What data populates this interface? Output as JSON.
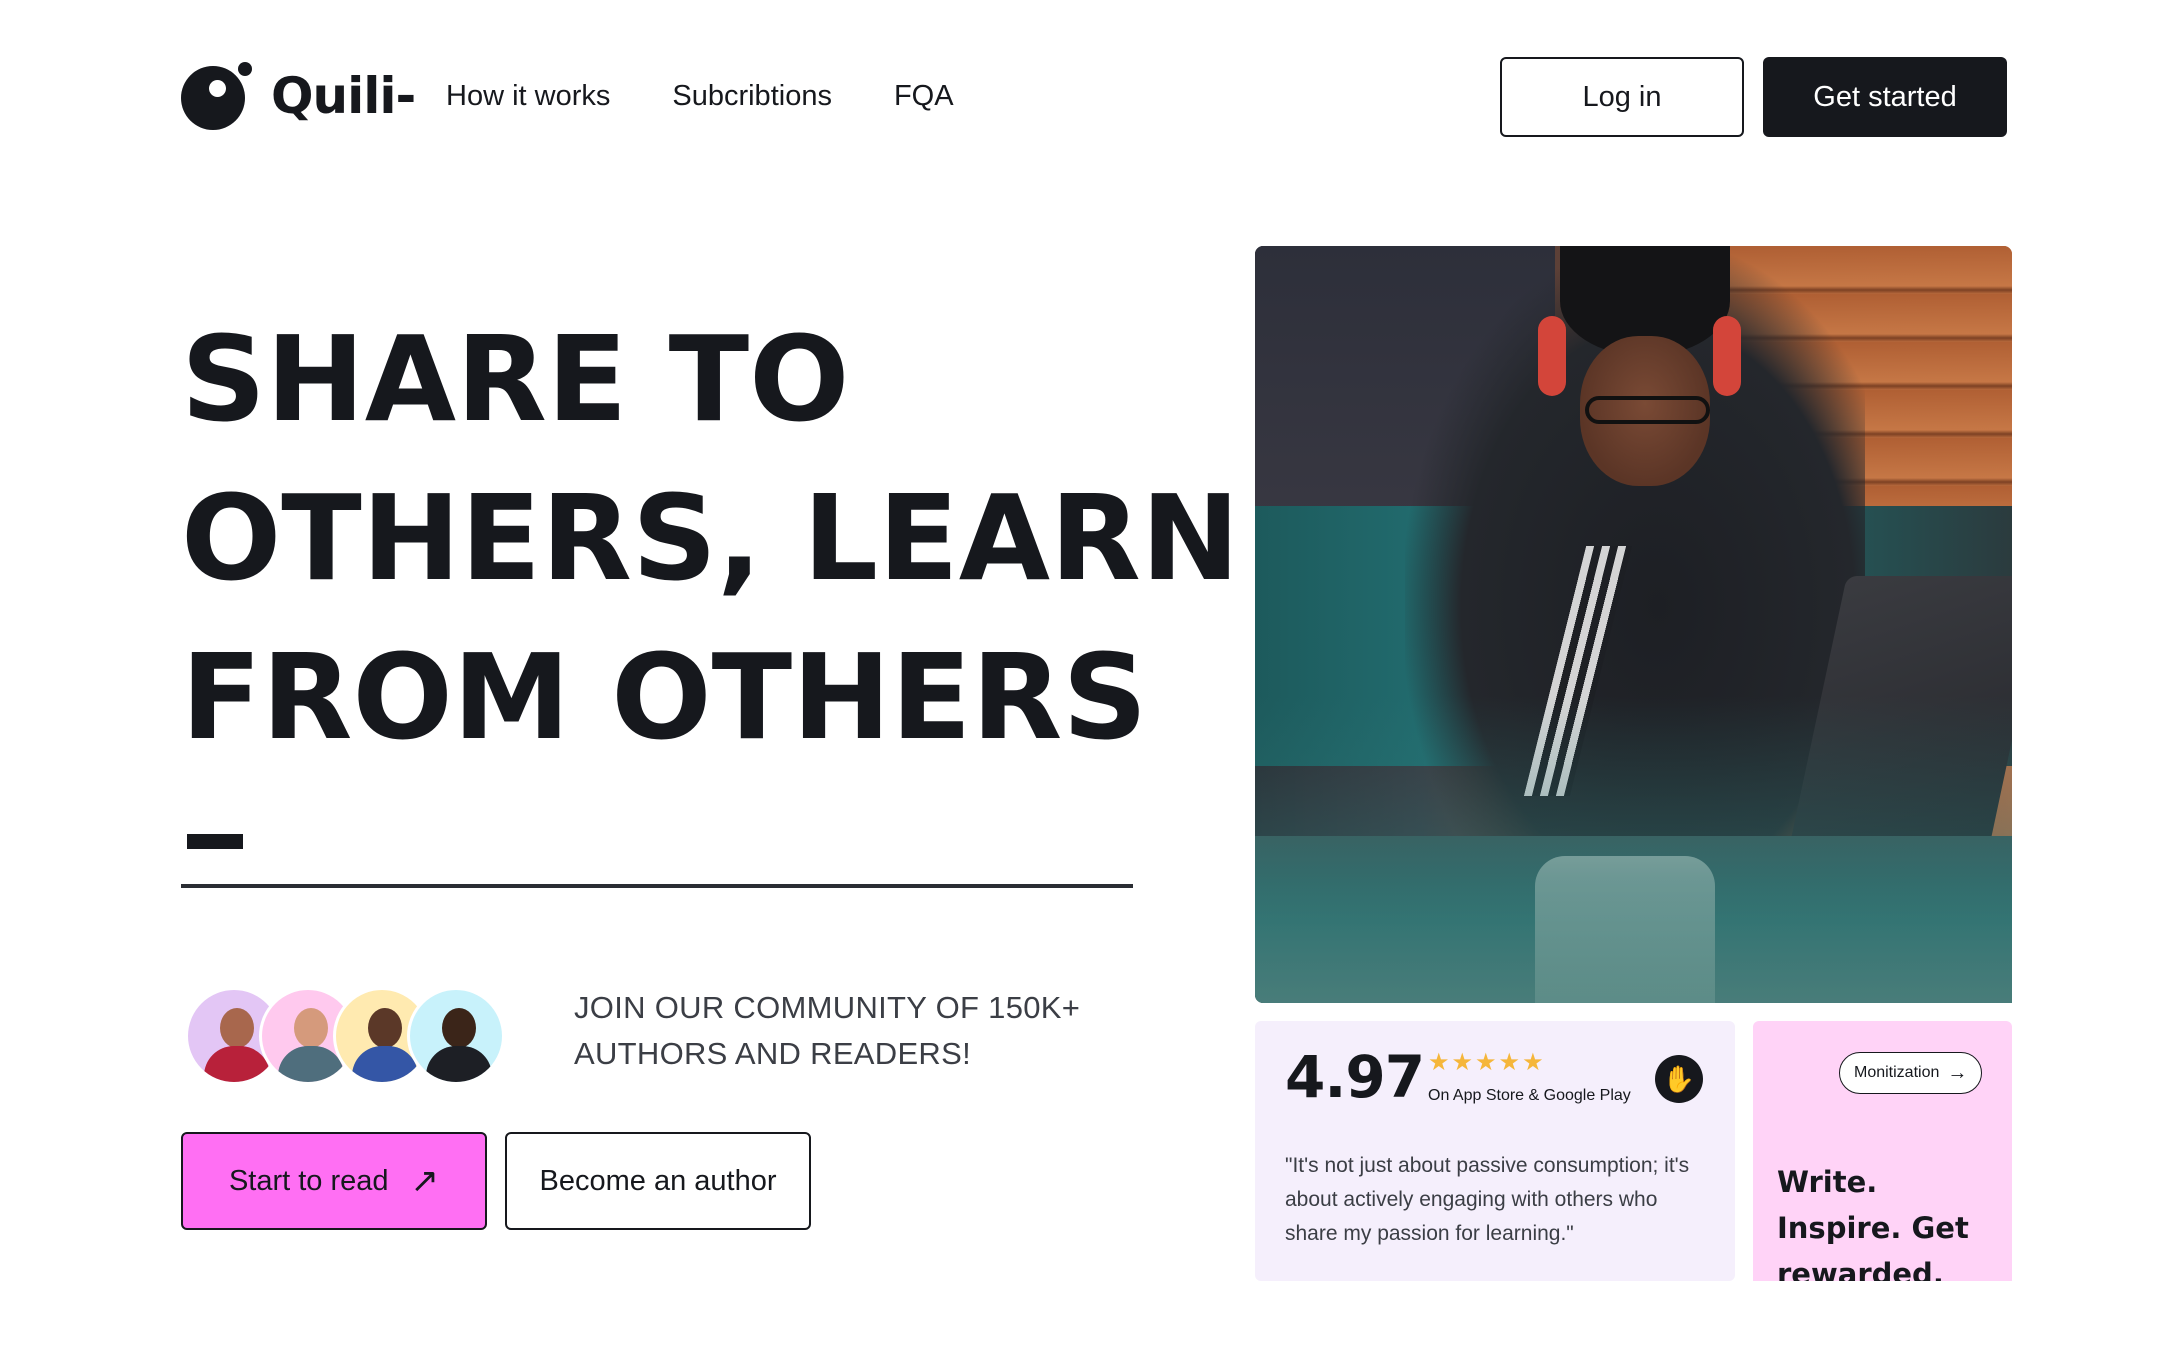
{
  "brand": {
    "name": "Quili-"
  },
  "nav": {
    "items": [
      {
        "label": "How it works"
      },
      {
        "label": "Subcribtions"
      },
      {
        "label": "FQA"
      }
    ]
  },
  "header": {
    "login_label": "Log in",
    "get_started_label": "Get started"
  },
  "hero": {
    "title_lines": [
      "SHARE TO",
      "OTHERS, LEARN",
      "FROM OTHERS"
    ],
    "community_text": "JOIN OUR COMMUNITY OF 150K+ AUTHORS AND READERS!",
    "start_read_label": "Start to read",
    "start_read_icon": "arrow-up-right-icon",
    "become_author_label": "Become an author"
  },
  "avatars": [
    {
      "name": "avatar-1",
      "bg": "#e3c6f5"
    },
    {
      "name": "avatar-2",
      "bg": "#ffc9ee"
    },
    {
      "name": "avatar-3",
      "bg": "#ffeab0"
    },
    {
      "name": "avatar-4",
      "bg": "#c8f2fb"
    }
  ],
  "rating": {
    "score": "4.97",
    "stars": 5,
    "source": "On App Store & Google Play",
    "icon": "clap-icon",
    "quote": "\"It's not just about passive consumption; it's about actively engaging with others who share my passion for learning.\""
  },
  "monetization": {
    "pill_label": "Monitization",
    "pill_icon": "arrow-right-icon",
    "title": "Write. Inspire. Get rewarded."
  },
  "colors": {
    "primary": "#16181d",
    "accent_pink": "#ff6ff3",
    "card_lavender": "#f5effc",
    "card_pink": "#ffd3f7",
    "star": "#f5b63a"
  }
}
